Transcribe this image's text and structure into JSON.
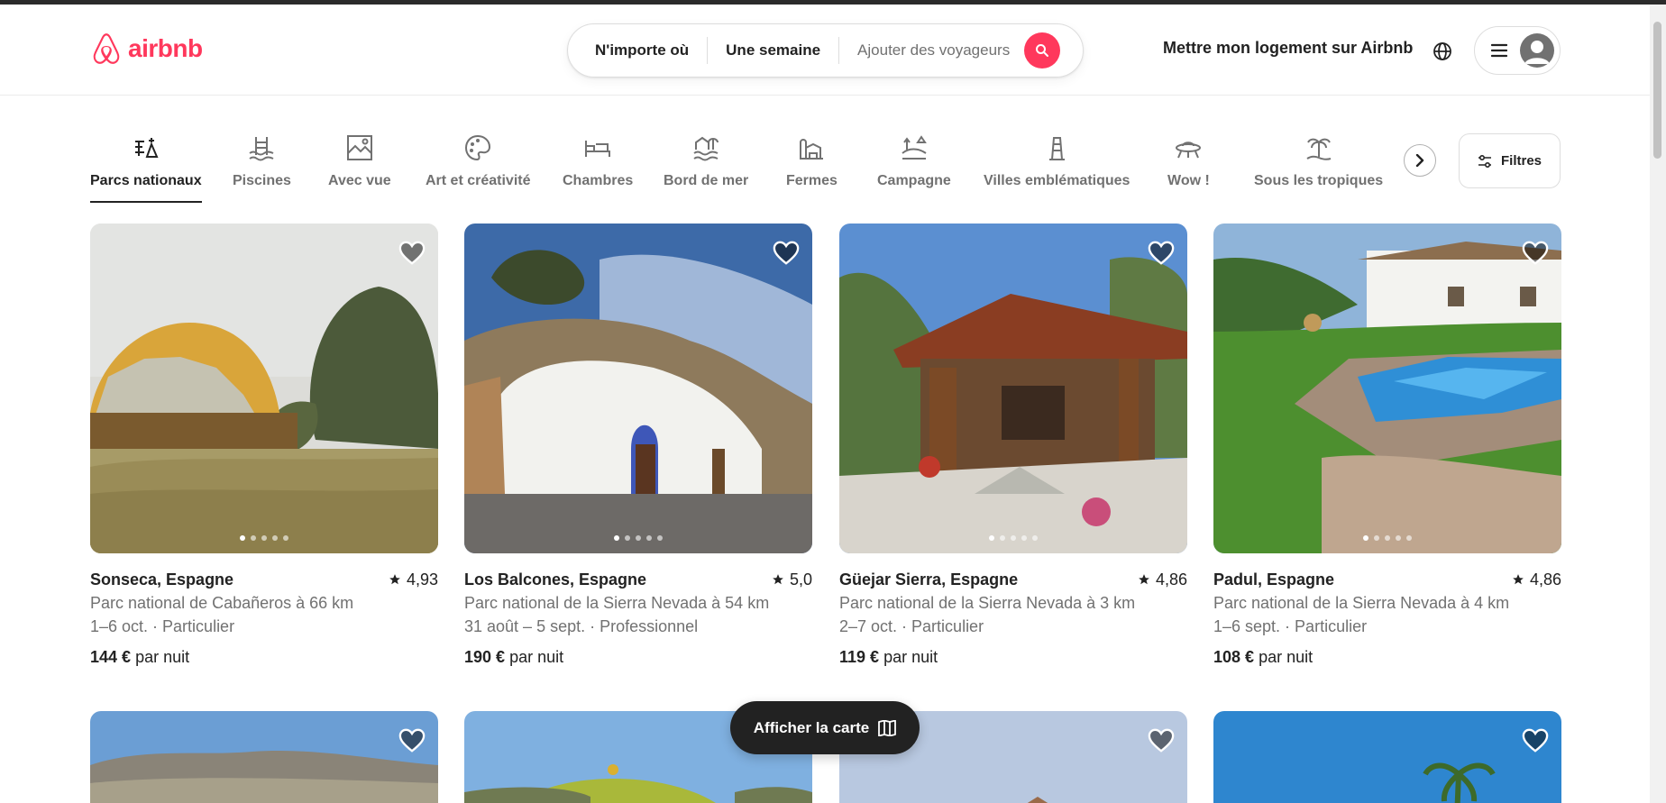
{
  "header": {
    "logo_text": "airbnb",
    "search": {
      "where": "N'importe où",
      "when": "Une semaine",
      "guests_placeholder": "Ajouter des voyageurs"
    },
    "host_link": "Mettre mon logement sur Airbnb"
  },
  "categories": {
    "items": [
      {
        "label": "Parcs nationaux",
        "icon": "national-park-icon",
        "active": true
      },
      {
        "label": "Piscines",
        "icon": "pool-icon"
      },
      {
        "label": "Avec vue",
        "icon": "view-icon"
      },
      {
        "label": "Art et créativité",
        "icon": "palette-icon"
      },
      {
        "label": "Chambres",
        "icon": "bed-icon"
      },
      {
        "label": "Bord de mer",
        "icon": "beachfront-icon"
      },
      {
        "label": "Fermes",
        "icon": "farm-icon"
      },
      {
        "label": "Campagne",
        "icon": "countryside-icon"
      },
      {
        "label": "Villes emblématiques",
        "icon": "iconic-city-icon"
      },
      {
        "label": "Wow !",
        "icon": "ufo-icon"
      },
      {
        "label": "Sous les tropiques",
        "icon": "palm-tree-icon"
      }
    ],
    "filters_label": "Filtres"
  },
  "listings": [
    {
      "location": "Sonseca, Espagne",
      "rating": "4,93",
      "distance": "Parc national de Cabañeros à 66 km",
      "dates": "1–6 oct. · Particulier",
      "price": "144 €",
      "price_suffix": "par nuit"
    },
    {
      "location": "Los Balcones, Espagne",
      "rating": "5,0",
      "distance": "Parc national de la Sierra Nevada à 54 km",
      "dates": "31 août – 5 sept. · Professionnel",
      "price": "190 €",
      "price_suffix": "par nuit"
    },
    {
      "location": "Güejar Sierra, Espagne",
      "rating": "4,86",
      "distance": "Parc national de la Sierra Nevada à 3 km",
      "dates": "2–7 oct. · Particulier",
      "price": "119 €",
      "price_suffix": "par nuit"
    },
    {
      "location": "Padul, Espagne",
      "rating": "4,86",
      "distance": "Parc national de la Sierra Nevada à 4 km",
      "dates": "1–6 sept. · Particulier",
      "price": "108 €",
      "price_suffix": "par nuit"
    }
  ],
  "map_button": "Afficher la carte",
  "colors": {
    "brand": "#ff385c",
    "text": "#222222",
    "muted": "#717171"
  }
}
